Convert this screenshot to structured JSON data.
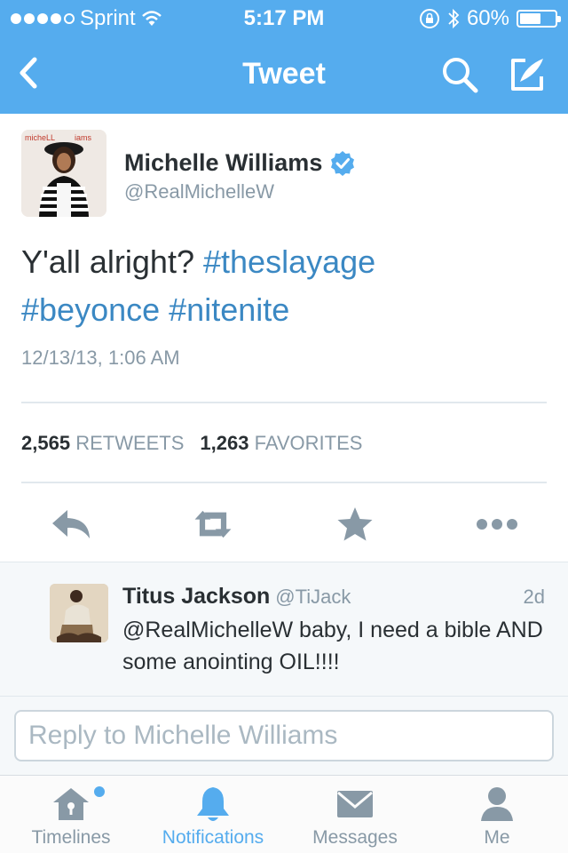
{
  "status_bar": {
    "carrier": "Sprint",
    "time": "5:17 PM",
    "battery": "60%",
    "battery_level": 0.6
  },
  "nav": {
    "title": "Tweet",
    "back_icon": "chevron-left-icon",
    "search_icon": "search-icon",
    "compose_icon": "compose-icon"
  },
  "tweet": {
    "author_name": "Michelle Williams",
    "author_handle": "@RealMichelleW",
    "text_plain": "Y'all alright?",
    "hashtags": [
      "#theslayage",
      "#beyonce",
      "#nitenite"
    ],
    "date": "12/13/13, 1:06 AM",
    "retweets_count": "2,565",
    "retweets_label": "RETWEETS",
    "favorites_count": "1,263",
    "favorites_label": "FAVORITES"
  },
  "reply": {
    "name": "Titus Jackson",
    "handle": "@TiJack",
    "time": "2d",
    "text": "@RealMichelleW baby, I need a bible AND some anointing OIL!!!!"
  },
  "compose": {
    "placeholder": "Reply to Michelle Williams"
  },
  "tabs": [
    {
      "label": "Timelines",
      "icon": "home-icon"
    },
    {
      "label": "Notifications",
      "icon": "bell-icon"
    },
    {
      "label": "Messages",
      "icon": "envelope-icon"
    },
    {
      "label": "Me",
      "icon": "person-icon"
    }
  ],
  "colors": {
    "brand": "#55acee",
    "hashtag": "#3b88c3",
    "muted": "#8899a6",
    "action_icon": "#8899a6"
  }
}
